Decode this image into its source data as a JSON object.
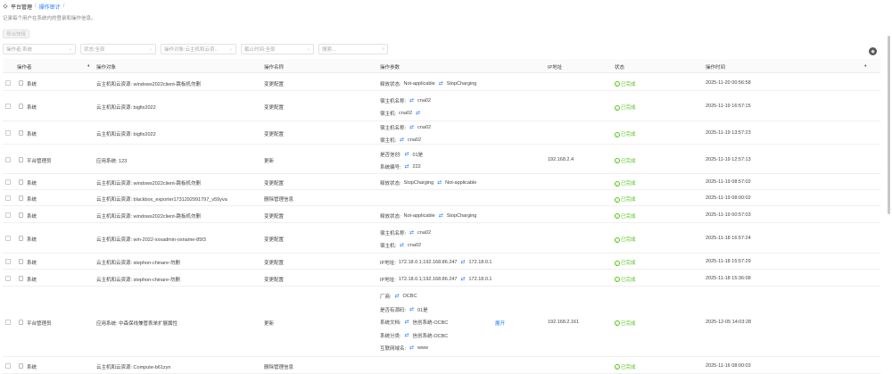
{
  "header": {
    "title": "平台管理",
    "separator": "/",
    "crumb": "操作审计",
    "crumb_sep": "/",
    "subtitle": "记录每个用户在系统内的登录和操作信息。"
  },
  "toolbar": {
    "export_label": "导出快报"
  },
  "filters": {
    "operator": "操作者:系统",
    "status": "状态:全部",
    "object": "操作对象:云主机和云资...",
    "time": "截止时间:全部",
    "search_placeholder": "搜索..."
  },
  "columns": {
    "operator": "操作者",
    "object": "操作对象",
    "name": "操作名称",
    "params": "操作参数",
    "ip": "IP地址",
    "status": "状态",
    "time": "操作时间",
    "sort_glyph": "♦"
  },
  "rows": [
    {
      "operator": "系统",
      "object": "云主机和云资源: windows2022client-跳板机勿删",
      "name": "变更配置",
      "params": [
        {
          "label": "释放状态:",
          "a": "Not-applicable",
          "b": "StopCharging"
        }
      ],
      "ip": "",
      "status": "已完成",
      "time": "2025-11-20 00:56:58"
    },
    {
      "operator": "系统",
      "object": "云主机和云资源: bigfix2022",
      "name": "变更配置",
      "params": [
        {
          "label": "宿主机名称:",
          "a": "",
          "b": "cna02"
        },
        {
          "label": "宿主机:",
          "a": "cna02",
          "b": ""
        }
      ],
      "ip": "",
      "status": "已完成",
      "time": "2025-11-19 16:57:15"
    },
    {
      "operator": "系统",
      "object": "云主机和云资源: bigfix2022",
      "name": "变更配置",
      "params": [
        {
          "label": "宿主机名称:",
          "a": "",
          "b": "cna02"
        },
        {
          "label": "宿主机:",
          "a": "",
          "b": "cna02"
        }
      ],
      "ip": "",
      "status": "已完成",
      "time": "2025-11-19 13:57:23"
    },
    {
      "operator": "平台管理员",
      "object": "应用系统: 123",
      "name": "更新",
      "params": [
        {
          "label": "是否信创:",
          "a": "",
          "b": "01是"
        },
        {
          "label": "系统编号:",
          "a": "",
          "b": "222"
        }
      ],
      "ip": "192.168.2.4",
      "status": "已完成",
      "time": "2025-11-19 12:57:13"
    },
    {
      "operator": "系统",
      "object": "云主机和云资源: windows2022client-跳板机勿删",
      "name": "变更配置",
      "params": [
        {
          "label": "释放状态:",
          "a": "StopCharging",
          "b": "Not-applicable"
        }
      ],
      "ip": "",
      "status": "已完成",
      "time": "2025-11-19 08:57:02"
    },
    {
      "operator": "系统",
      "object": "云主机和云资源: blackbox_exporter17312929917​97_v59yva",
      "name": "删除管理信息",
      "params": [],
      "ip": "",
      "status": "已完成",
      "time": "2025-11-19 08:00:02"
    },
    {
      "operator": "系统",
      "object": "云主机和云资源: windows2022client-跳板机勿删",
      "name": "变更配置",
      "params": [
        {
          "label": "释放状态:",
          "a": "Not-applicable",
          "b": "StopCharging"
        }
      ],
      "ip": "",
      "status": "已完成",
      "time": "2025-11-19 00:57:03"
    },
    {
      "operator": "系统",
      "object": "云主机和云资源: win-2022-xxxadmin-osname-85f3",
      "name": "变更配置",
      "params": [
        {
          "label": "宿主机名称:",
          "a": "",
          "b": "cna02"
        },
        {
          "label": "宿主机:",
          "a": "",
          "b": "cna02"
        }
      ],
      "ip": "",
      "status": "已完成",
      "time": "2025-11-18 16:57:24"
    },
    {
      "operator": "系统",
      "object": "云主机和云资源: stephon-chinare-勿删",
      "name": "变更配置",
      "params": [
        {
          "label": "IP地址:",
          "a": "172.18.0.1;192.168.86.247",
          "b": "172.18.0.1"
        }
      ],
      "ip": "",
      "status": "已完成",
      "time": "2025-11-18 15:57:29"
    },
    {
      "operator": "系统",
      "object": "云主机和云资源: stephon-chinare-勿删",
      "name": "变更配置",
      "params": [
        {
          "label": "IP地址:",
          "a": "172.18.0.1;192.168.86.247",
          "b": "172.18.0.1"
        }
      ],
      "ip": "",
      "status": "已完成",
      "time": "2025-11-18 15:36:08"
    },
    {
      "operator": "平台管理员",
      "object": "应用系统: 中森保线兼管表单扩展属性",
      "name": "更新",
      "more": "展开",
      "params": [
        {
          "label": "厂商:",
          "a": "",
          "b": "OCBC"
        },
        {
          "label": "是否有源码:",
          "a": "",
          "b": "01是"
        },
        {
          "label": "系统文档:",
          "a": "",
          "b": "信创系统-OCBC"
        },
        {
          "label": "系统分类:",
          "a": "",
          "b": "信创系统-OCBC"
        },
        {
          "label": "互联网域名:",
          "a": "",
          "b": "www"
        }
      ],
      "ip": "192.168.2.161",
      "status": "已完成",
      "time": "2025-12-05 14:03:28"
    },
    {
      "operator": "系统",
      "object": "云主机和云资源: Compute-b61zyn",
      "name": "删除管理信息",
      "params": [],
      "ip": "",
      "status": "已完成",
      "time": "2025-11-16 08:00:03"
    }
  ],
  "icons": {
    "swap": "swap-arrows-icon",
    "status_ok": "check-circle-icon",
    "settings": "settings-icon",
    "column_toggle": "eye-icon"
  }
}
